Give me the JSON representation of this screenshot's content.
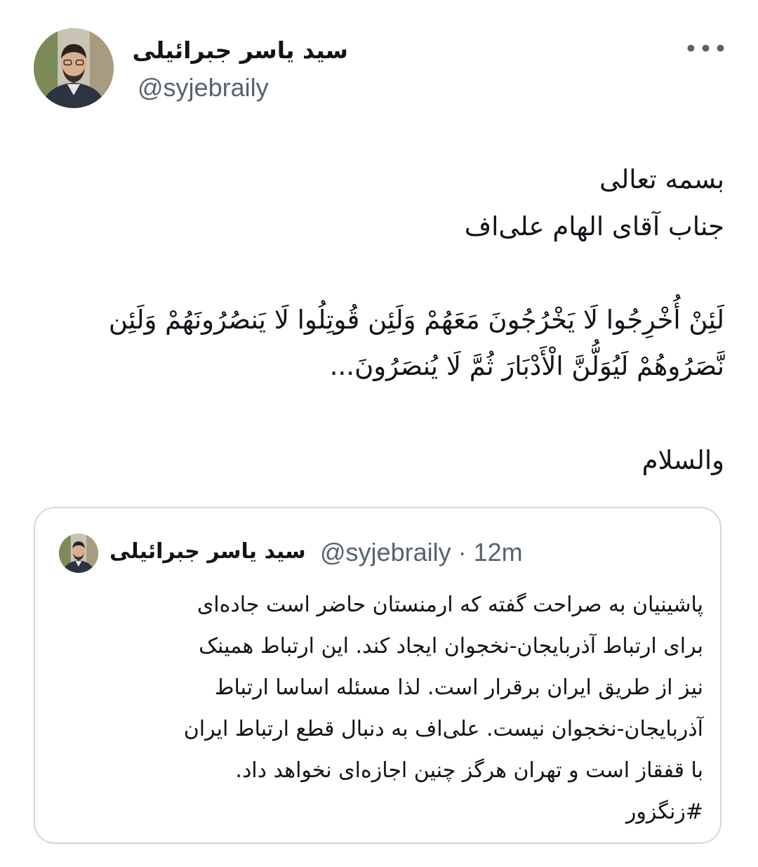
{
  "author": {
    "display_name": "سید یاسر جبرائیلی",
    "handle": "@syjebraily",
    "avatar_icon": "profile-photo"
  },
  "more_icon": "more-horizontal-icon",
  "more_label": "•••",
  "tweet": {
    "lines": [
      "بسمه تعالی",
      "جناب آقای الهام علی‌اف",
      "",
      "لَئِنْ أُخْرِجُوا لَا يَخْرُجُونَ مَعَهُمْ وَلَئِن قُوتِلُوا لَا يَنصُرُونَهُمْ وَلَئِن نَّصَرُوهُمْ لَيُوَلُّنَّ الْأَدْبَارَ ثُمَّ لَا يُنصَرُونَ...",
      "",
      "والسلام"
    ]
  },
  "quote": {
    "display_name": "سید یاسر جبرائیلی",
    "meta": "@syjebraily · 12m",
    "lines": [
      "پاشینیان به صراحت گفته که ارمنستان حاضر است جاده‌ای",
      "برای ارتباط آذربایجان-نخجوان ایجاد کند. این ارتباط همینک",
      "نیز از طریق ایران برقرار است. لذا مسئله اساسا ارتباط",
      "آذربایجان-نخجوان نیست. علی‌اف به دنبال قطع ارتباط ایران",
      "با قفقاز است و تهران هرگز چنین اجازه‌ای نخواهد داد.",
      "#زنگزور"
    ]
  },
  "colors": {
    "text": "#0f1419",
    "secondary": "#536471",
    "border": "#cfd9de"
  }
}
